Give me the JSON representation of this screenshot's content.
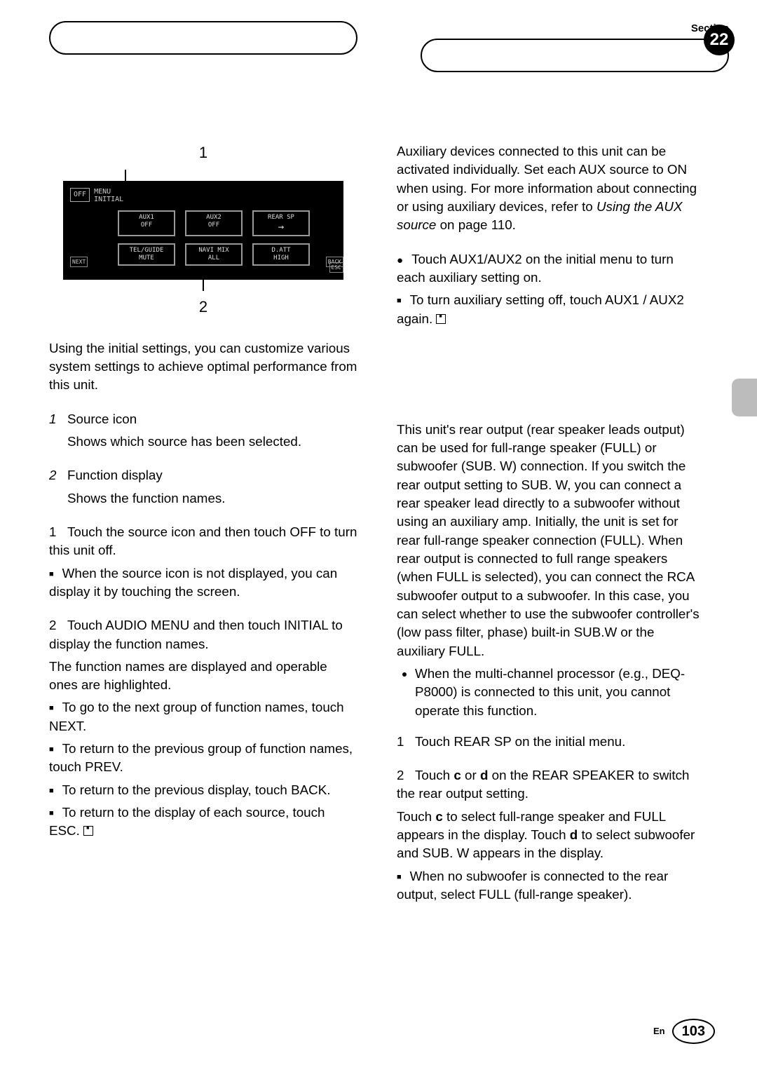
{
  "header": {
    "section_label": "Section",
    "section_number": "22"
  },
  "figure": {
    "label_1": "1",
    "label_2": "2",
    "off": "OFF",
    "menu_l1": "MENU",
    "menu_l2": "INITIAL",
    "row1": {
      "c1_l1": "AUX1",
      "c1_l2": "OFF",
      "c2_l1": "AUX2",
      "c2_l2": "OFF",
      "c3_l1": "REAR SP"
    },
    "row2": {
      "c1_l1": "TEL/GUIDE",
      "c1_l2": "MUTE",
      "c2_l1": "NAVI MIX",
      "c2_l2": "ALL",
      "c3_l1": "D.ATT",
      "c3_l2": "HIGH"
    },
    "next": "NEXT",
    "back": "BACK",
    "esc": "ESC"
  },
  "left": {
    "intro": "Using the initial settings, you can customize various system settings to achieve optimal performance from this unit.",
    "item1_num": "1",
    "item1_title": "Source icon",
    "item1_desc": "Shows which source has been selected.",
    "item2_num": "2",
    "item2_title": "Function display",
    "item2_desc": "Shows the function names.",
    "step1_num": "1",
    "step1_text": "Touch the source icon and then touch OFF to turn this unit off.",
    "step1_note": "When the source icon is not displayed, you can display it by touching the screen.",
    "step2_num": "2",
    "step2_text": "Touch AUDIO MENU and then touch INITIAL to display the function names.",
    "step2_sub": "The function names are displayed and operable ones are highlighted.",
    "b1": "To go to the next group of function names, touch NEXT.",
    "b2": "To return to the previous group of function names, touch PREV.",
    "b3": "To return to the previous display, touch BACK.",
    "b4_pre": "To return to the display of each source, touch ESC."
  },
  "right": {
    "aux_intro_a": "Auxiliary devices connected to this unit can be activated individually. Set each AUX source to ON when using. For more information about connecting or using auxiliary devices, refer to ",
    "aux_intro_i": "Using the AUX source",
    "aux_intro_b": " on page 110.",
    "aux_b1": "Touch AUX1/AUX2 on the initial menu to turn each auxiliary setting on.",
    "aux_b2_pre": "To turn auxiliary setting off, touch AUX1 / AUX2 again.",
    "rear_intro": "This unit's rear output (rear speaker leads output) can be used for full-range speaker (FULL) or subwoofer (SUB. W) connection. If you switch the rear output setting to SUB. W, you can connect a rear speaker lead directly to a subwoofer without using an auxiliary amp. Initially, the unit is set for rear full-range speaker connection (FULL). When rear output is connected to full range speakers (when FULL is selected), you can connect the RCA subwoofer output to a subwoofer. In this case, you can select whether to use the subwoofer controller's (low pass filter, phase) built-in SUB.W or the auxiliary FULL.",
    "rear_li": "When the multi-channel processor (e.g., DEQ-P8000) is connected to this unit, you cannot operate this function.",
    "rear_s1_num": "1",
    "rear_s1": "Touch REAR SP on the initial menu.",
    "rear_s2_num": "2",
    "rear_s2_a": "Touch ",
    "rear_s2_c": "c",
    "rear_s2_b": " or ",
    "rear_s2_d": "d",
    "rear_s2_e": " on the REAR SPEAKER to switch the rear output setting.",
    "rear_s2_sub_a": "Touch ",
    "rear_s2_sub_c": "c",
    "rear_s2_sub_b": " to select full-range speaker and FULL appears in the display. Touch ",
    "rear_s2_sub_d": "d",
    "rear_s2_sub_e": " to select subwoofer and SUB. W appears in the display.",
    "rear_note": "When no subwoofer is connected to the rear output, select FULL (full-range speaker)."
  },
  "footer": {
    "lang": "En",
    "page": "103"
  }
}
